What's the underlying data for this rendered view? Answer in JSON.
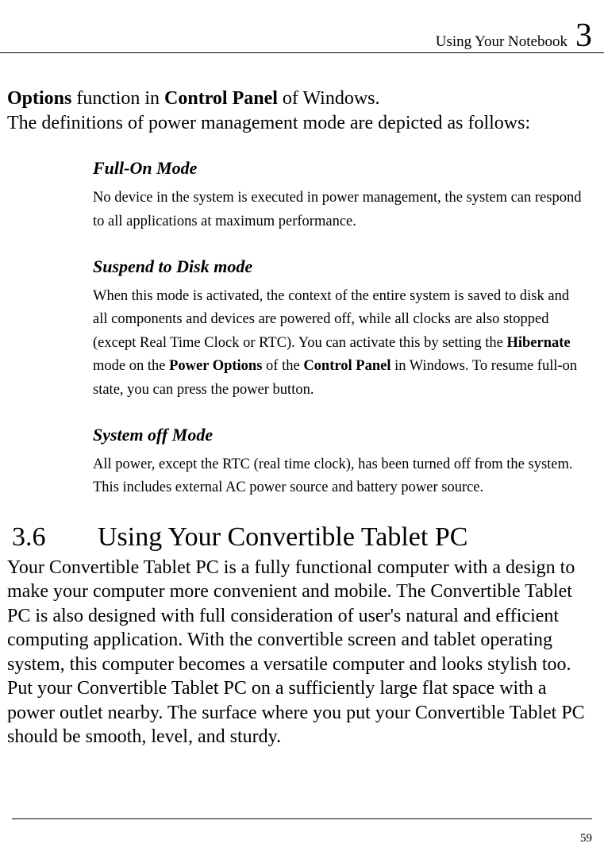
{
  "header": {
    "title": "Using Your Notebook",
    "chapter_number": "3"
  },
  "intro": {
    "options_bold": "Options",
    "part1": " function in ",
    "control_panel_bold": "Control Panel",
    "part2": " of Windows.",
    "line2": "The definitions of power management mode are depicted as follows:"
  },
  "modes": {
    "full_on": {
      "heading": "Full-On Mode",
      "body": "No device in the system is executed in power management, the system can respond to all applications at maximum performance."
    },
    "suspend": {
      "heading": "Suspend to Disk mode",
      "body_p1": "When this mode is activated, the context of the entire system is saved to disk and all components and devices are powered off, while all clocks are also stopped (except Real Time Clock or RTC). You can activate this by setting the ",
      "hibernate_bold": "Hibernate",
      "body_p2": " mode on the ",
      "power_options_bold": "Power Options",
      "body_p3": " of the ",
      "control_panel_bold": "Control Panel",
      "body_p4": " in Windows. To resume full-on state, you can press the power button."
    },
    "system_off": {
      "heading": "System off Mode",
      "body": "All power, except the RTC (real time clock), has been turned off from the system. This includes external AC power source and battery power source."
    }
  },
  "section": {
    "number": "3.6",
    "title": "Using Your Convertible Tablet PC",
    "body": "Your Convertible Tablet PC is a fully functional computer with a design to make your computer more convenient and mobile. The Convertible Tablet PC is also designed with full consideration of user's natural and efficient computing application. With the convertible screen and tablet operating system, this computer becomes a versatile computer and looks stylish too. Put your Convertible Tablet PC on a sufficiently large flat space with a power outlet nearby. The surface where you put your Convertible Tablet PC should be smooth, level, and sturdy."
  },
  "footer": {
    "page_number": "59"
  }
}
